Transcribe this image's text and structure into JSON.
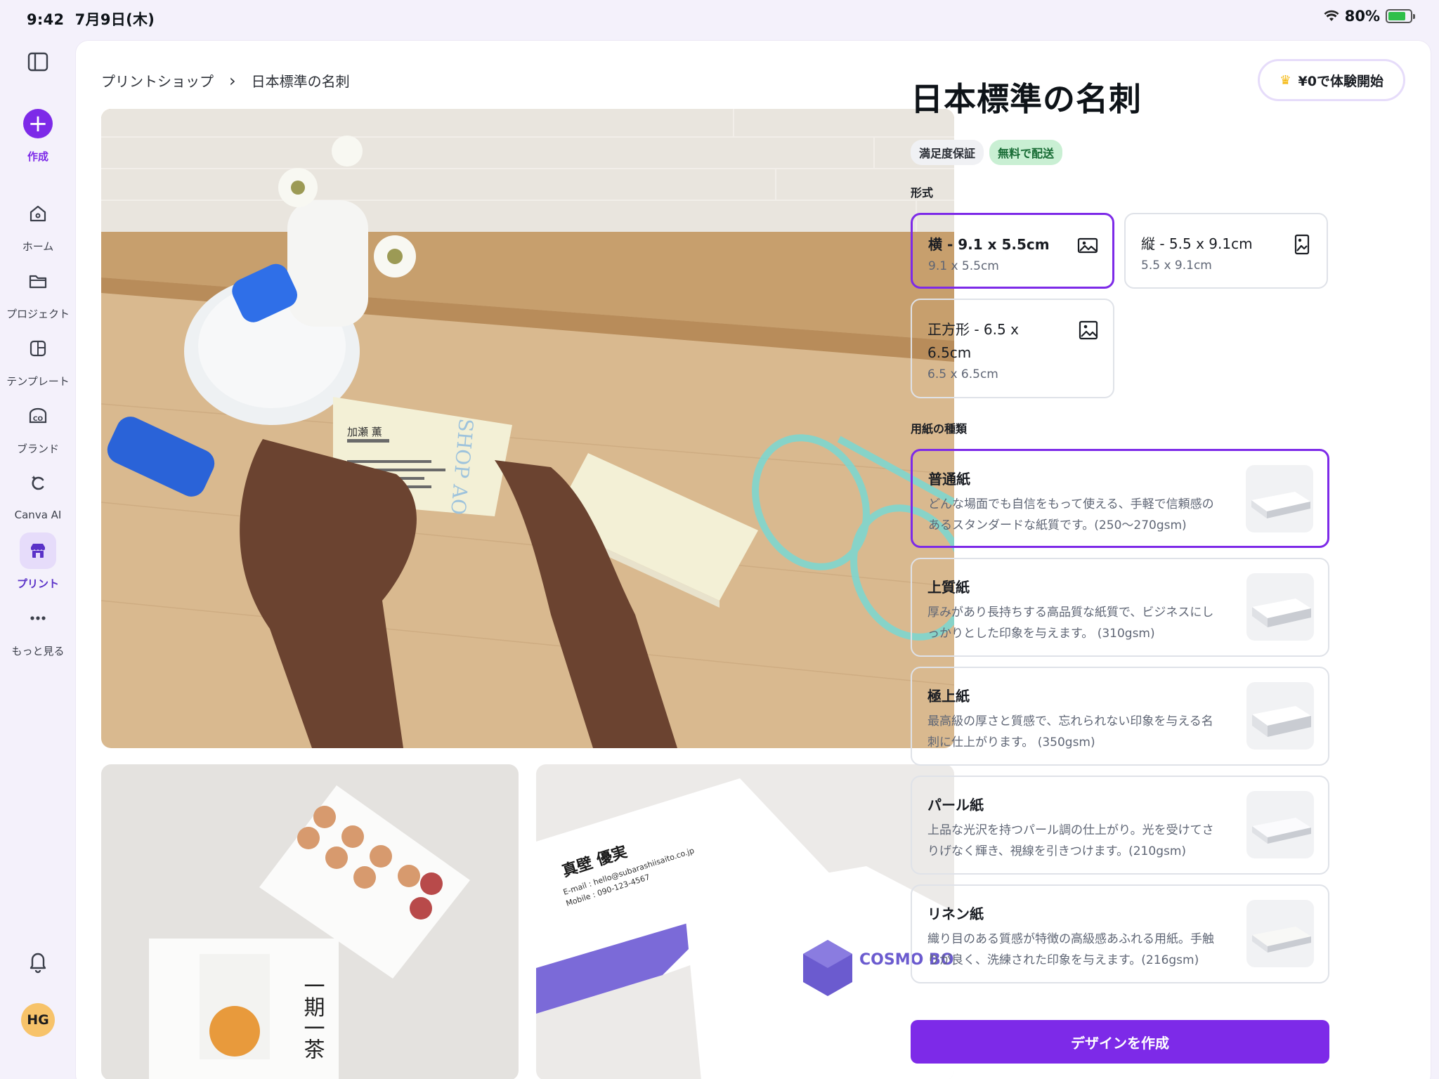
{
  "status_bar": {
    "time": "9:42",
    "date": "7月9日(木)",
    "battery": "80%",
    "battery_level": 0.8
  },
  "sidebar": {
    "items": [
      {
        "label": "作成",
        "icon": "plus-icon"
      },
      {
        "label": "ホーム",
        "icon": "home-icon"
      },
      {
        "label": "プロジェクト",
        "icon": "folder-icon"
      },
      {
        "label": "テンプレート",
        "icon": "template-icon"
      },
      {
        "label": "ブランド",
        "icon": "brand-icon"
      },
      {
        "label": "Canva AI",
        "icon": "canva-ai-icon"
      },
      {
        "label": "プリント",
        "icon": "print-shop-icon"
      },
      {
        "label": "もっと見る",
        "icon": "more-icon"
      }
    ],
    "avatar_initials": "HG"
  },
  "breadcrumb": {
    "root": "プリントショップ",
    "current": "日本標準の名刺"
  },
  "trial_button": "¥0で体験開始",
  "product": {
    "title": "日本標準の名刺",
    "badges": [
      "満足度保証",
      "無料で配送"
    ]
  },
  "format_section": {
    "label": "形式",
    "options": [
      {
        "name": "横 - 9.1 x 5.5cm",
        "size": "9.1 x 5.5cm",
        "selected": true
      },
      {
        "name": "縦 - 5.5 x 9.1cm",
        "size": "5.5 x 9.1cm",
        "selected": false
      },
      {
        "name": "正方形 - 6.5 x 6.5cm",
        "size": "6.5 x 6.5cm",
        "selected": false
      }
    ]
  },
  "paper_section": {
    "label": "用紙の種類",
    "options": [
      {
        "name": "普通紙",
        "desc": "どんな場面でも自信をもって使える、手軽で信頼感のあるスタンダードな紙質です。(250〜270gsm)",
        "selected": true
      },
      {
        "name": "上質紙",
        "desc": "厚みがあり長持ちする高品質な紙質で、ビジネスにしっかりとした印象を与えます。 (310gsm)",
        "selected": false
      },
      {
        "name": "極上紙",
        "desc": "最高級の厚さと質感で、忘れられない印象を与える名刺に仕上がります。 (350gsm)",
        "selected": false
      },
      {
        "name": "パール紙",
        "desc": "上品な光沢を持つパール調の仕上がり。光を受けてさりげなく輝き、視線を引きつけます。(210gsm)",
        "selected": false
      },
      {
        "name": "リネン紙",
        "desc": "織り目のある質感が特徴の高級感あふれる用紙。手触りが良く、洗練された印象を与えます。(216gsm)",
        "selected": false
      }
    ]
  },
  "cta_button": "デザインを作成",
  "photos": {
    "card1": {
      "title": "加瀬 薫",
      "brand": "SHOP AO"
    },
    "card2": {
      "title": "一期一茶"
    },
    "card3": {
      "name": "真壁 優実",
      "brand": "COSMO BOX",
      "email": "E-mail : hello@subarashiisaito.co.jp",
      "mobile": "Mobile : 090-123-4567"
    }
  },
  "colors": {
    "accent": "#7d2ae8",
    "badge_green": "#c9efd3",
    "selected_border": "#7d2ae8"
  }
}
